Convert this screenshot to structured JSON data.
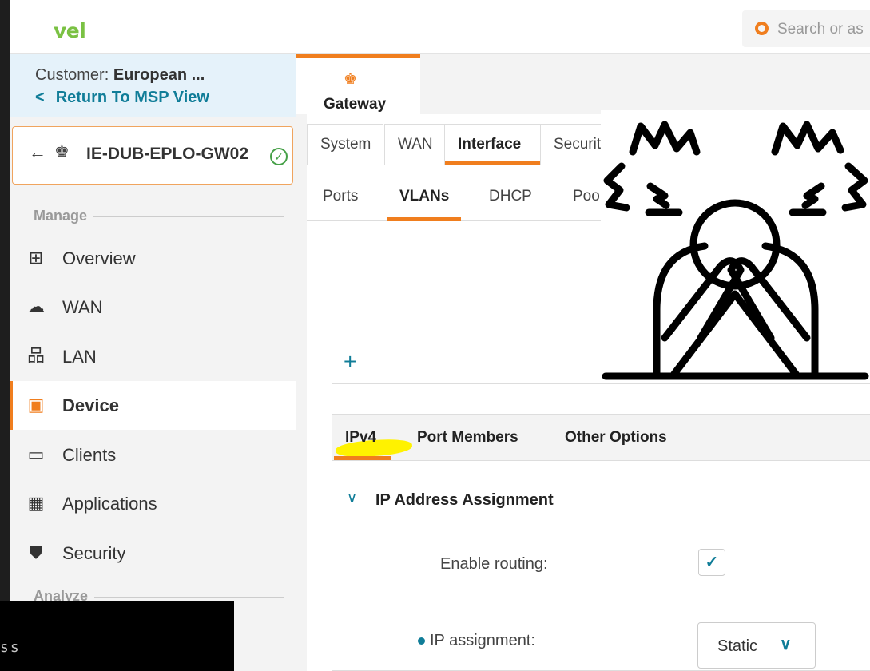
{
  "app": {
    "logo_text": "vel",
    "search_placeholder": "Search or as"
  },
  "sidebar": {
    "customer_prefix": "Customer: ",
    "customer_name": "European ...",
    "return_label": "Return To MSP View",
    "device_name": "IE-DUB-EPLO-GW02",
    "device_status": "online",
    "section_manage": "Manage",
    "section_analyze": "Analyze",
    "items": [
      {
        "label": "Overview",
        "icon": "overview-icon",
        "glyph": "⊞"
      },
      {
        "label": "WAN",
        "icon": "cloud-icon",
        "glyph": "☁"
      },
      {
        "label": "LAN",
        "icon": "lan-icon",
        "glyph": "品"
      },
      {
        "label": "Device",
        "icon": "device-icon",
        "glyph": "▣",
        "active": true
      },
      {
        "label": "Clients",
        "icon": "clients-icon",
        "glyph": "▭"
      },
      {
        "label": "Applications",
        "icon": "applications-icon",
        "glyph": "▦"
      },
      {
        "label": "Security",
        "icon": "shield-icon",
        "glyph": "⛊"
      }
    ]
  },
  "main": {
    "gateway_tab": "Gateway",
    "tabs_level1": [
      "System",
      "WAN",
      "Interface",
      "Securit"
    ],
    "tabs_level1_active": "Interface",
    "tabs_level2": [
      "Ports",
      "VLANs",
      "DHCP",
      "Poo"
    ],
    "tabs_level2_active": "VLANs",
    "add_label": "+",
    "panel_tabs": [
      "IPv4",
      "Port Members",
      "Other Options"
    ],
    "panel_tab_active": "IPv4",
    "accordion_title": "IP Address Assignment",
    "enable_routing_label": "Enable routing:",
    "enable_routing_checked": true,
    "ip_assignment_label": "IP assignment:",
    "ip_assignment_value": "Static"
  },
  "overlay": {
    "terminal_text": "ss"
  },
  "colors": {
    "accent": "#f07e1e",
    "link": "#107d98",
    "logo": "#7ac143",
    "highlight": "#fff200"
  }
}
